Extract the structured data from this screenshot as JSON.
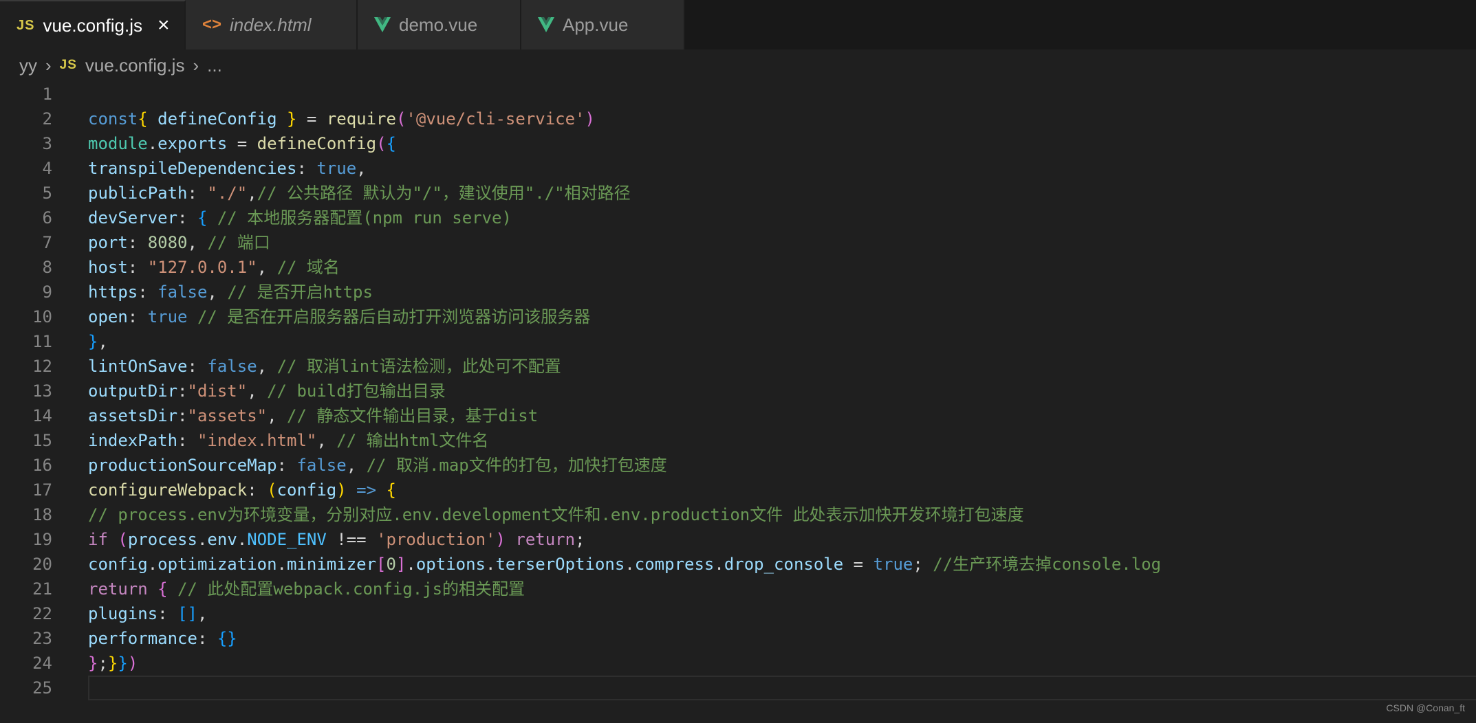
{
  "tabs": [
    {
      "label": "vue.config.js",
      "icon": "js-icon",
      "active": true
    },
    {
      "label": "index.html",
      "icon": "html-icon",
      "active": false,
      "italic": true
    },
    {
      "label": "demo.vue",
      "icon": "vue-icon",
      "active": false
    },
    {
      "label": "App.vue",
      "icon": "vue-icon",
      "active": false
    }
  ],
  "js_badge": "JS",
  "html_glyph": "<>",
  "close_glyph": "×",
  "breadcrumb": {
    "folder": "yy",
    "file": "vue.config.js",
    "more": "...",
    "separator": "›"
  },
  "lines": [
    [],
    [
      [
        "kw",
        "const"
      ],
      [
        "",
        ""
      ],
      [
        "b1",
        "{"
      ],
      [
        "var",
        " defineConfig "
      ],
      [
        "b1",
        "}"
      ],
      [
        "",
        " = "
      ],
      [
        "fn",
        "require"
      ],
      [
        "b2",
        "("
      ],
      [
        "str",
        "'@vue/cli-service'"
      ],
      [
        "b2",
        ")"
      ]
    ],
    [
      [
        "cls",
        "module"
      ],
      [
        "",
        "."
      ],
      [
        "var",
        "exports"
      ],
      [
        "",
        " = "
      ],
      [
        "fn",
        "defineConfig"
      ],
      [
        "b2",
        "("
      ],
      [
        "b3",
        "{"
      ]
    ],
    [
      [
        "var",
        "transpileDependencies"
      ],
      [
        "",
        ": "
      ],
      [
        "kw",
        "true"
      ],
      [
        "",
        ","
      ]
    ],
    [
      [
        "var",
        "publicPath"
      ],
      [
        "",
        ": "
      ],
      [
        "str",
        "\"./\""
      ],
      [
        "",
        ","
      ],
      [
        "cmt",
        "// 公共路径 默认为\"/\"，建议使用\"./\"相对路径"
      ]
    ],
    [
      [
        "var",
        "devServer"
      ],
      [
        "",
        ": "
      ],
      [
        "b3",
        "{"
      ],
      [
        "",
        " "
      ],
      [
        "cmt",
        "// 本地服务器配置(npm run serve)"
      ]
    ],
    [
      [
        "var",
        "port"
      ],
      [
        "",
        ": "
      ],
      [
        "num",
        "8080"
      ],
      [
        "",
        ", "
      ],
      [
        "cmt",
        "// 端口"
      ]
    ],
    [
      [
        "var",
        "host"
      ],
      [
        "",
        ": "
      ],
      [
        "str",
        "\"127.0.0.1\""
      ],
      [
        "",
        ", "
      ],
      [
        "cmt",
        "// 域名"
      ]
    ],
    [
      [
        "var",
        "https"
      ],
      [
        "",
        ": "
      ],
      [
        "kw",
        "false"
      ],
      [
        "",
        ", "
      ],
      [
        "cmt",
        "// 是否开启https"
      ]
    ],
    [
      [
        "var",
        "open"
      ],
      [
        "",
        ": "
      ],
      [
        "kw",
        "true"
      ],
      [
        "",
        " "
      ],
      [
        "cmt",
        "// 是否在开启服务器后自动打开浏览器访问该服务器"
      ]
    ],
    [
      [
        "b3",
        "}"
      ],
      [
        "",
        ","
      ]
    ],
    [
      [
        "var",
        "lintOnSave"
      ],
      [
        "",
        ": "
      ],
      [
        "kw",
        "false"
      ],
      [
        "",
        ", "
      ],
      [
        "cmt",
        "// 取消lint语法检测，此处可不配置"
      ]
    ],
    [
      [
        "var",
        "outputDir"
      ],
      [
        "",
        ":"
      ],
      [
        "str",
        "\"dist\""
      ],
      [
        "",
        ", "
      ],
      [
        "cmt",
        "// build打包输出目录"
      ]
    ],
    [
      [
        "var",
        "assetsDir"
      ],
      [
        "",
        ":"
      ],
      [
        "str",
        "\"assets\""
      ],
      [
        "",
        ", "
      ],
      [
        "cmt",
        "// 静态文件输出目录，基于dist"
      ]
    ],
    [
      [
        "var",
        "indexPath"
      ],
      [
        "",
        ": "
      ],
      [
        "str",
        "\"index.html\""
      ],
      [
        "",
        ", "
      ],
      [
        "cmt",
        "// 输出html文件名"
      ]
    ],
    [
      [
        "var",
        "productionSourceMap"
      ],
      [
        "",
        ": "
      ],
      [
        "kw",
        "false"
      ],
      [
        "",
        ", "
      ],
      [
        "cmt",
        "// 取消.map文件的打包，加快打包速度"
      ]
    ],
    [
      [
        "fn",
        "configureWebpack"
      ],
      [
        "",
        ": "
      ],
      [
        "b1",
        "("
      ],
      [
        "var",
        "config"
      ],
      [
        "b1",
        ")"
      ],
      [
        "",
        " "
      ],
      [
        "kw",
        "=>"
      ],
      [
        "",
        " "
      ],
      [
        "b1",
        "{"
      ]
    ],
    [
      [
        "cmt",
        "// process.env为环境变量，分别对应.env.development文件和.env.production文件 此处表示加快开发环境打包速度"
      ]
    ],
    [
      [
        "ctrl",
        "if"
      ],
      [
        "",
        " "
      ],
      [
        "b2",
        "("
      ],
      [
        "var",
        "process"
      ],
      [
        "",
        "."
      ],
      [
        "var",
        "env"
      ],
      [
        "",
        "."
      ],
      [
        "const",
        "NODE_ENV"
      ],
      [
        "",
        " !== "
      ],
      [
        "str",
        "'production'"
      ],
      [
        "b2",
        ")"
      ],
      [
        "",
        " "
      ],
      [
        "ctrl",
        "return"
      ],
      [
        "",
        ";"
      ]
    ],
    [
      [
        "var",
        "config"
      ],
      [
        "",
        "."
      ],
      [
        "var",
        "optimization"
      ],
      [
        "",
        "."
      ],
      [
        "var",
        "minimizer"
      ],
      [
        "b2",
        "["
      ],
      [
        "num",
        "0"
      ],
      [
        "b2",
        "]"
      ],
      [
        "",
        "."
      ],
      [
        "var",
        "options"
      ],
      [
        "",
        "."
      ],
      [
        "var",
        "terserOptions"
      ],
      [
        "",
        "."
      ],
      [
        "var",
        "compress"
      ],
      [
        "",
        "."
      ],
      [
        "var",
        "drop_console"
      ],
      [
        "",
        " = "
      ],
      [
        "kw",
        "true"
      ],
      [
        "",
        "; "
      ],
      [
        "cmt",
        "//生产环境去掉console.log"
      ]
    ],
    [
      [
        "ctrl",
        "return"
      ],
      [
        "",
        " "
      ],
      [
        "b2",
        "{"
      ],
      [
        "",
        " "
      ],
      [
        "cmt",
        "// 此处配置webpack.config.js的相关配置"
      ]
    ],
    [
      [
        "var",
        "plugins"
      ],
      [
        "",
        ": "
      ],
      [
        "b3",
        "[]"
      ],
      [
        "",
        ","
      ]
    ],
    [
      [
        "var",
        "performance"
      ],
      [
        "",
        ": "
      ],
      [
        "b3",
        "{}"
      ]
    ],
    [
      [
        "b2",
        "}"
      ],
      [
        "",
        ";"
      ],
      [
        "b1",
        "}"
      ],
      [
        "b3",
        "}"
      ],
      [
        "b2",
        ")"
      ]
    ],
    []
  ],
  "watermark": "CSDN @Conan_ft"
}
